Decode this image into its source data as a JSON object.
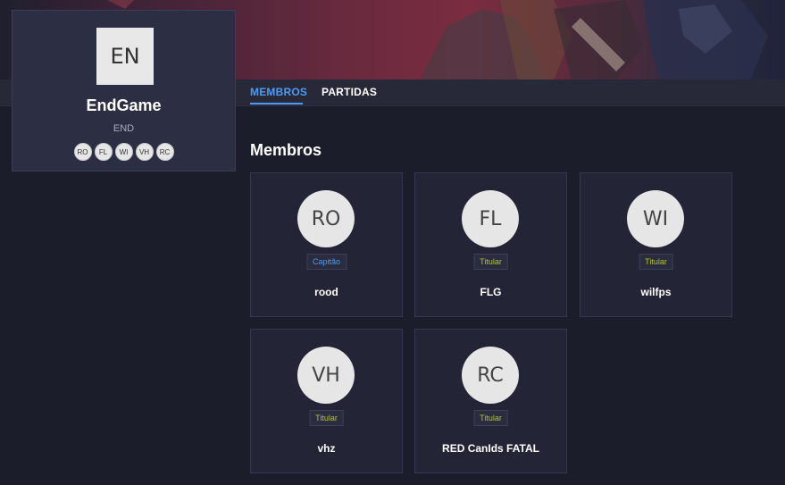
{
  "tabs": [
    {
      "label": "MEMBROS"
    },
    {
      "label": "PARTIDAS"
    }
  ],
  "team": {
    "logo_text": "EN",
    "name": "EndGame",
    "tag": "END",
    "member_initials": [
      "RO",
      "FL",
      "WI",
      "VH",
      "RC"
    ]
  },
  "members_section": {
    "title": "Membros",
    "members": [
      {
        "initials": "RO",
        "role": "Capitão",
        "name": "rood"
      },
      {
        "initials": "FL",
        "role": "Titular",
        "name": "FLG"
      },
      {
        "initials": "WI",
        "role": "Titular",
        "name": "wilfps"
      },
      {
        "initials": "VH",
        "role": "Titular",
        "name": "vhz"
      },
      {
        "initials": "RC",
        "role": "Titular",
        "name": "RED CanIds FATAL"
      }
    ]
  },
  "colors": {
    "accent": "#4e9bf5",
    "captain": "#4e9bf5",
    "starter": "#b6c62a",
    "background": "#1c1d2b"
  }
}
